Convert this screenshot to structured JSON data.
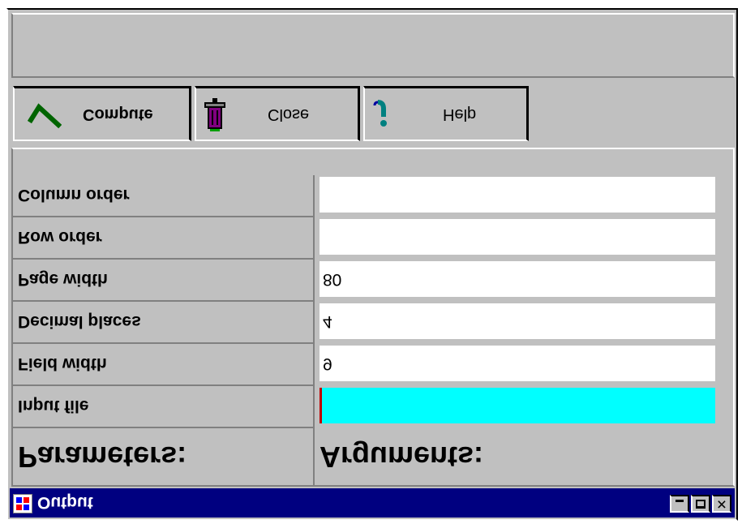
{
  "window": {
    "title": "Output",
    "controls": {
      "minimize": "minimize",
      "maximize": "maximize",
      "close": "close"
    }
  },
  "grid": {
    "headers": {
      "parameters": "Parameters:",
      "arguments": "Arguments:"
    },
    "rows": [
      {
        "label": "Input file",
        "value": "",
        "active": true
      },
      {
        "label": "Field width",
        "value": "9"
      },
      {
        "label": "Decimal places",
        "value": "4"
      },
      {
        "label": "Page width",
        "value": "80"
      },
      {
        "label": "Row order",
        "value": ""
      },
      {
        "label": "Column order",
        "value": ""
      }
    ]
  },
  "toolbar": {
    "compute_label": "Compute",
    "close_label": "Close",
    "help_label": "Help"
  },
  "icons": {
    "compute": "check-icon",
    "close": "trash-can-icon",
    "help": "question-mark-icon",
    "app": "app-grid-icon"
  },
  "colors": {
    "title_bar": "#000080",
    "active_field": "#00ffff",
    "field": "#ffffff",
    "face": "#c0c0c0",
    "check": "#006400",
    "trash": "#800080",
    "help": "#008080"
  }
}
